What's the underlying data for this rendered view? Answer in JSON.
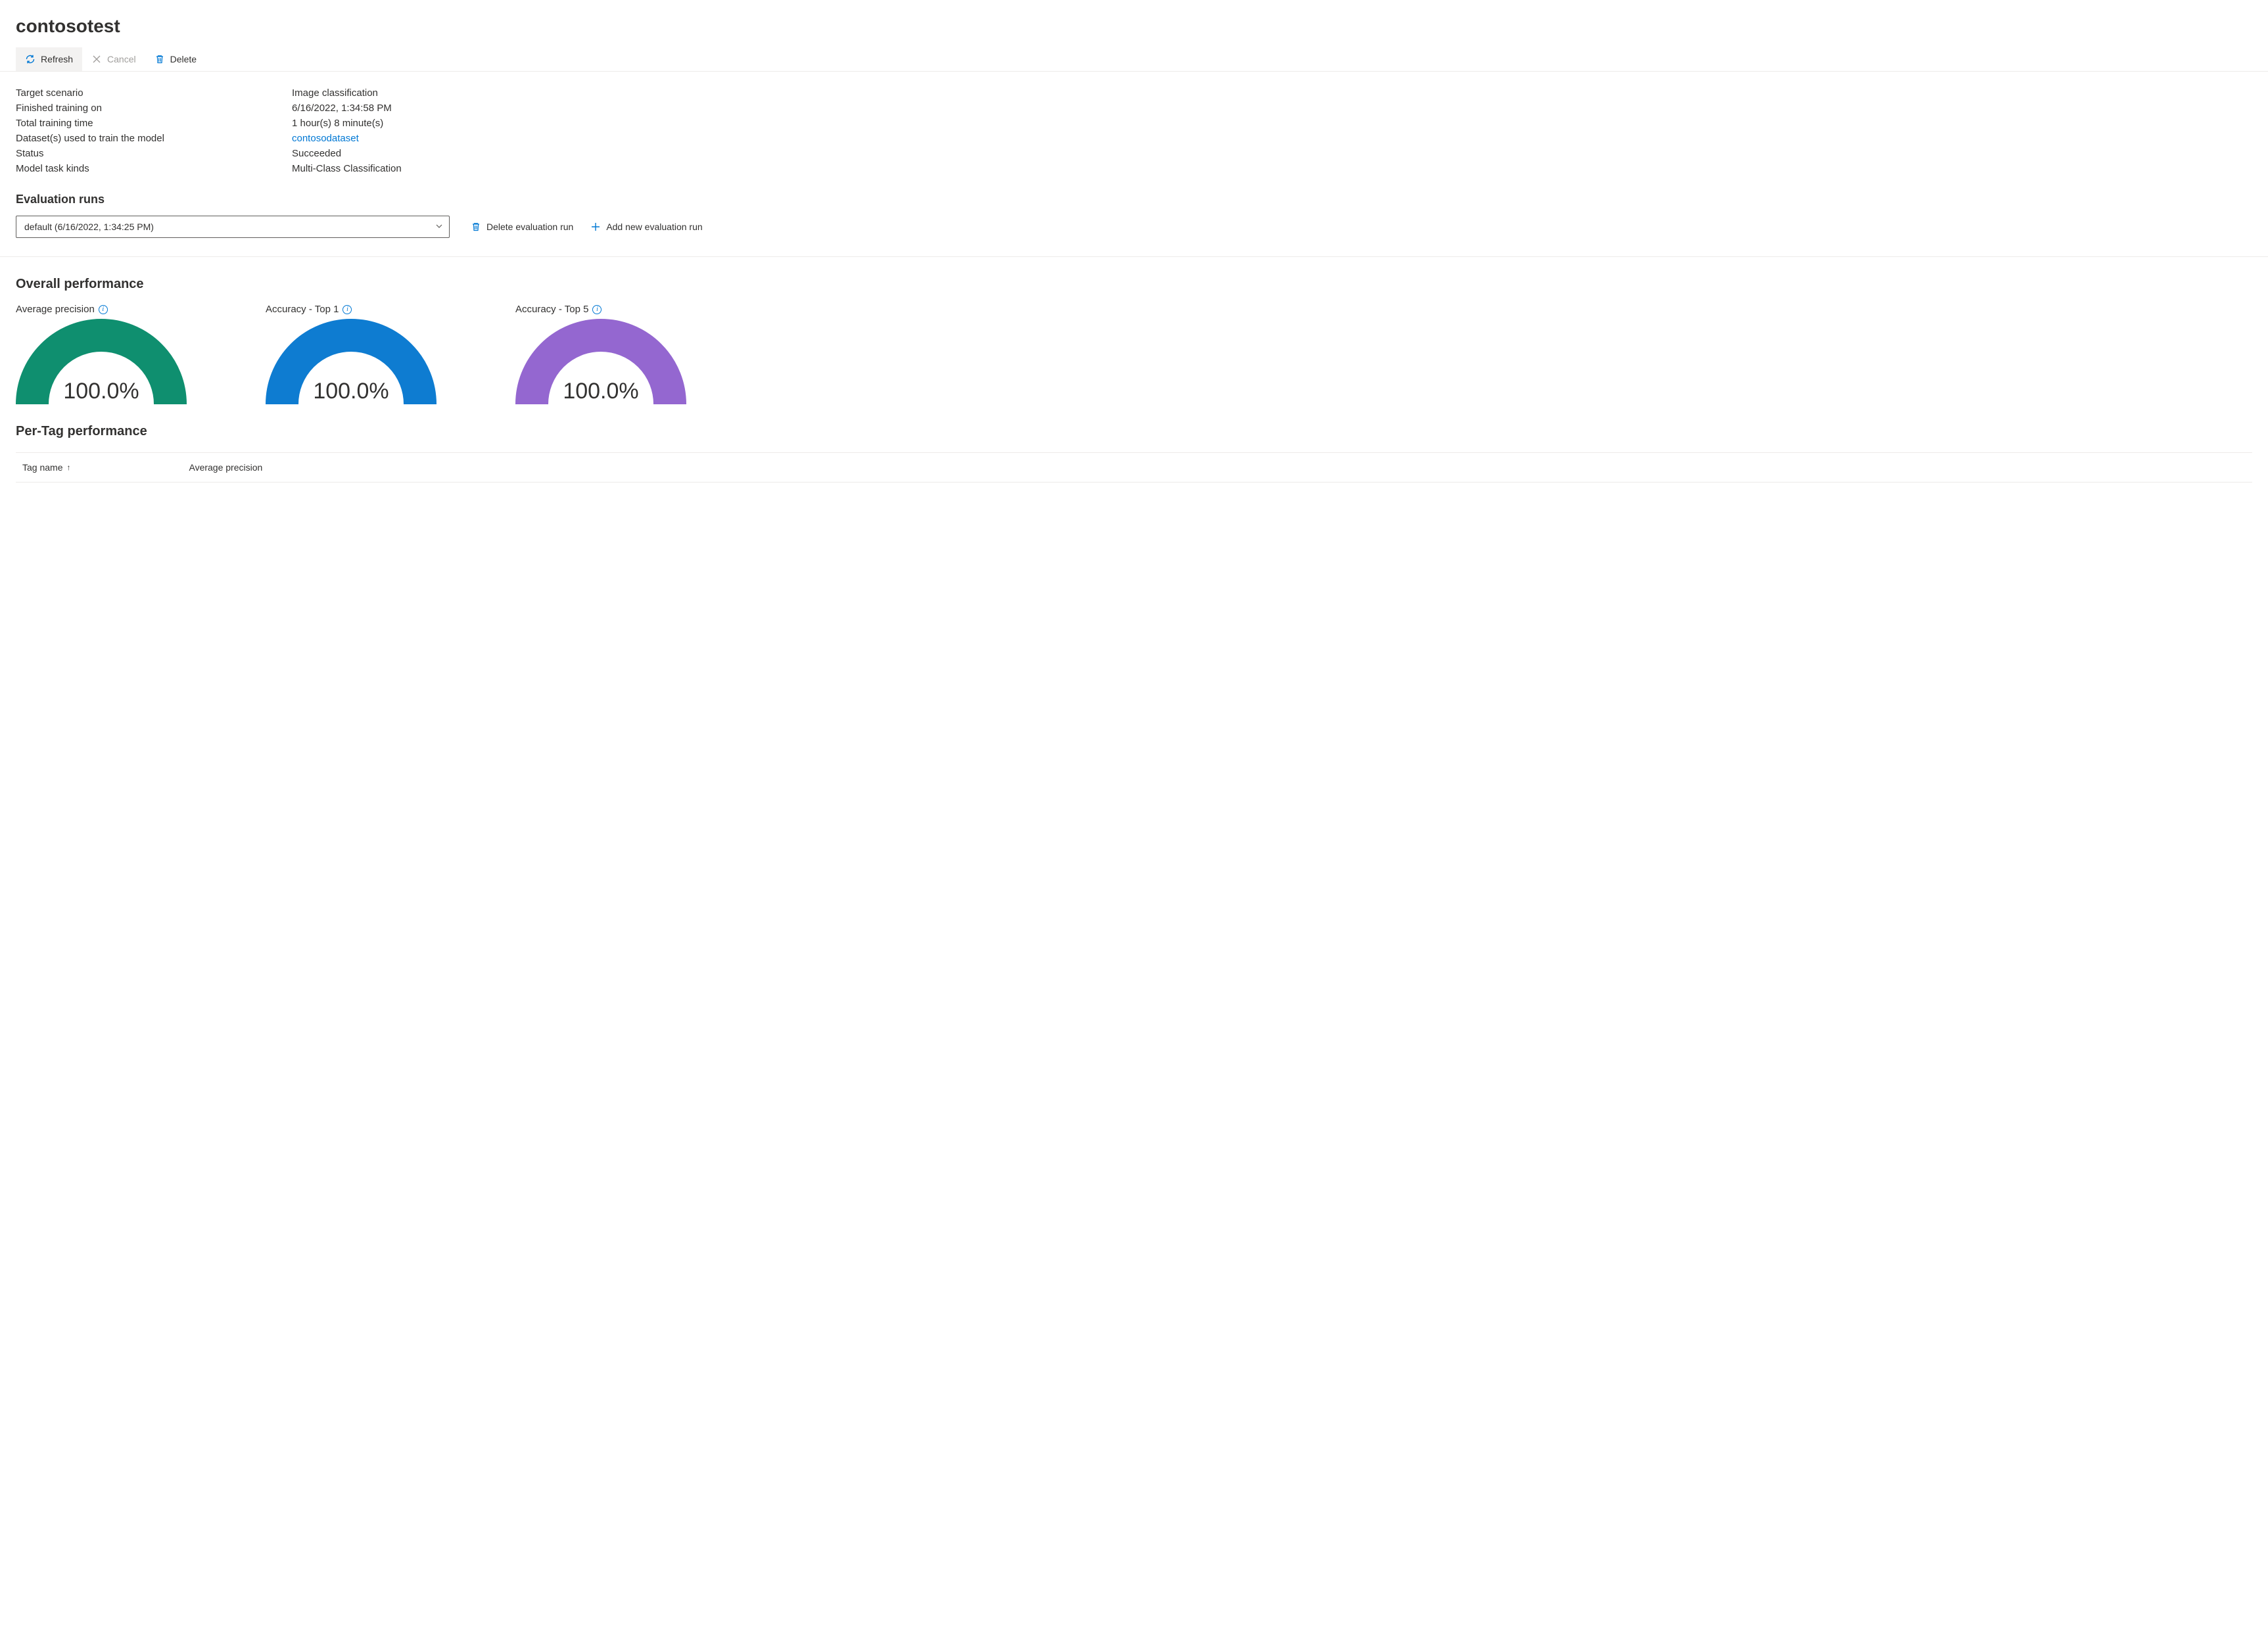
{
  "page_title": "contosotest",
  "toolbar": {
    "refresh_label": "Refresh",
    "cancel_label": "Cancel",
    "delete_label": "Delete"
  },
  "details": {
    "target_scenario_label": "Target scenario",
    "target_scenario_value": "Image classification",
    "finished_on_label": "Finished training on",
    "finished_on_value": "6/16/2022, 1:34:58 PM",
    "training_time_label": "Total training time",
    "training_time_value": "1 hour(s) 8 minute(s)",
    "datasets_label": "Dataset(s) used to train the model",
    "datasets_value": "contosodataset",
    "status_label": "Status",
    "status_value": "Succeeded",
    "task_kinds_label": "Model task kinds",
    "task_kinds_value": "Multi-Class Classification"
  },
  "evaluation": {
    "section_title": "Evaluation runs",
    "selected_run": "default (6/16/2022, 1:34:25 PM)",
    "delete_run_label": "Delete evaluation run",
    "add_run_label": "Add new evaluation run"
  },
  "overall_performance": {
    "section_title": "Overall performance",
    "gauges": [
      {
        "label": "Average precision",
        "value": "100.0%",
        "color": "#0f8f6f"
      },
      {
        "label": "Accuracy - Top 1",
        "value": "100.0%",
        "color": "#0e7cd1"
      },
      {
        "label": "Accuracy - Top 5",
        "value": "100.0%",
        "color": "#9467d0"
      }
    ]
  },
  "per_tag": {
    "section_title": "Per-Tag performance",
    "col_tag_name": "Tag name",
    "col_avg_precision": "Average precision"
  },
  "chart_data": [
    {
      "type": "gauge",
      "title": "Average precision",
      "value": 100.0,
      "unit": "%",
      "range": [
        0,
        100
      ]
    },
    {
      "type": "gauge",
      "title": "Accuracy - Top 1",
      "value": 100.0,
      "unit": "%",
      "range": [
        0,
        100
      ]
    },
    {
      "type": "gauge",
      "title": "Accuracy - Top 5",
      "value": 100.0,
      "unit": "%",
      "range": [
        0,
        100
      ]
    }
  ]
}
